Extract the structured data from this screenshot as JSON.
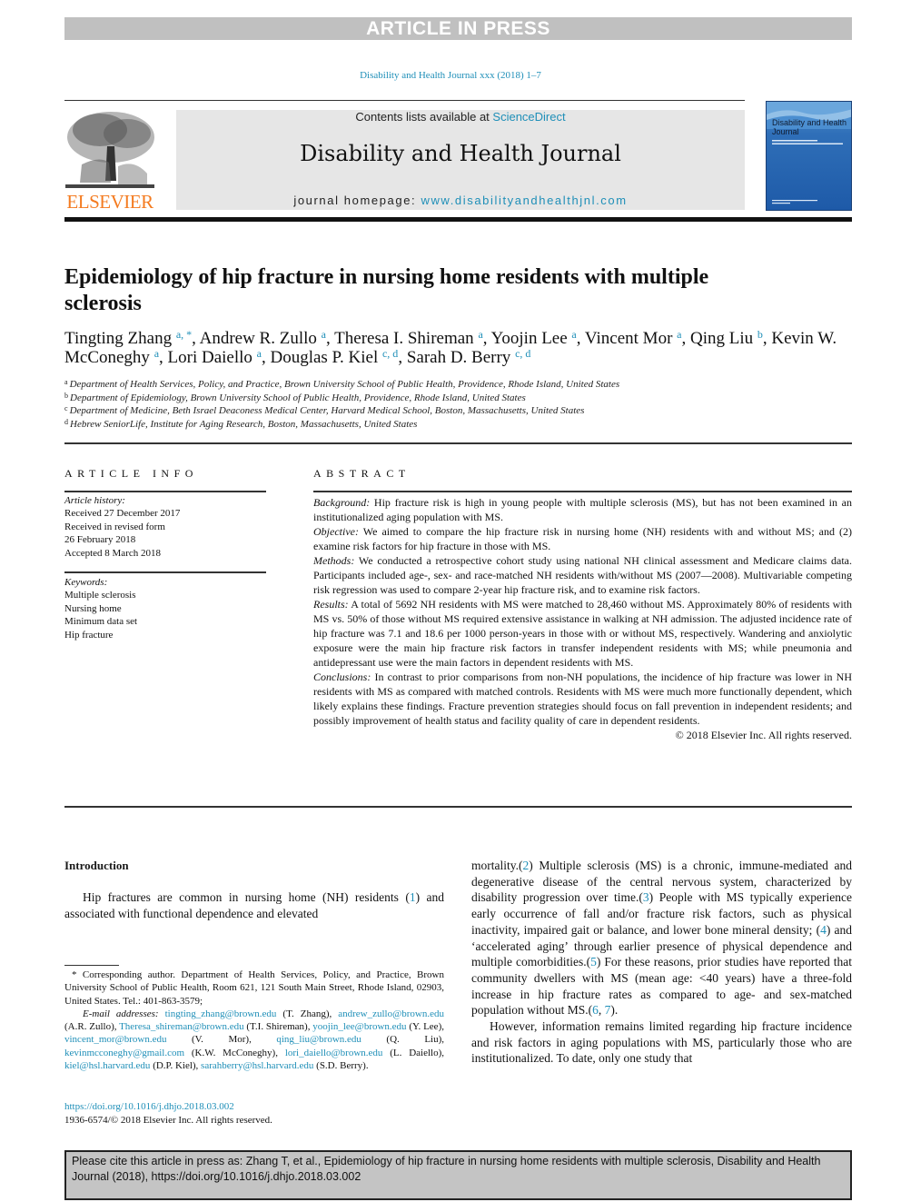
{
  "banner": {
    "text": "ARTICLE IN PRESS"
  },
  "journal_ref": "Disability and Health Journal xxx (2018) 1–7",
  "masthead": {
    "publisher_wordmark": "ELSEVIER",
    "publisher_logo_icon": "elsevier-tree-icon",
    "contents_prefix": "Contents lists available at ",
    "contents_link": "ScienceDirect",
    "journal_name": "Disability and Health Journal",
    "homepage_prefix": "journal homepage: ",
    "homepage_link": "www.disabilityandhealthjnl.com",
    "cover_title": "Disability and Health Journal"
  },
  "article": {
    "title": "Epidemiology of hip fracture in nursing home residents with multiple sclerosis",
    "authors": [
      {
        "name": "Tingting Zhang",
        "sup": "a, *",
        "sep": ", "
      },
      {
        "name": "Andrew R. Zullo",
        "sup": "a",
        "sep": ", "
      },
      {
        "name": "Theresa I. Shireman",
        "sup": "a",
        "sep": ", "
      },
      {
        "name": "Yoojin Lee",
        "sup": "a",
        "sep": ", "
      },
      {
        "name": "Vincent Mor",
        "sup": "a",
        "sep": ", "
      },
      {
        "name": "Qing Liu",
        "sup": "b",
        "sep": ", "
      },
      {
        "name": "Kevin W. McConeghy",
        "sup": "a",
        "sep": ", "
      },
      {
        "name": "Lori Daiello",
        "sup": "a",
        "sep": ", "
      },
      {
        "name": "Douglas P. Kiel",
        "sup": "c, d",
        "sep": ", "
      },
      {
        "name": "Sarah D. Berry",
        "sup": "c, d",
        "sep": ""
      }
    ],
    "affiliations": [
      {
        "key": "a",
        "text": "Department of Health Services, Policy, and Practice, Brown University School of Public Health, Providence, Rhode Island, United States"
      },
      {
        "key": "b",
        "text": "Department of Epidemiology, Brown University School of Public Health, Providence, Rhode Island, United States"
      },
      {
        "key": "c",
        "text": "Department of Medicine, Beth Israel Deaconess Medical Center, Harvard Medical School, Boston, Massachusetts, United States"
      },
      {
        "key": "d",
        "text": "Hebrew SeniorLife, Institute for Aging Research, Boston, Massachusetts, United States"
      }
    ]
  },
  "article_info": {
    "heading": "ARTICLE INFO",
    "history_label": "Article history:",
    "history": [
      "Received 27 December 2017",
      "Received in revised form",
      "26 February 2018",
      "Accepted 8 March 2018"
    ],
    "keywords_label": "Keywords:",
    "keywords": [
      "Multiple sclerosis",
      "Nursing home",
      "Minimum data set",
      "Hip fracture"
    ]
  },
  "abstract": {
    "heading": "ABSTRACT",
    "sections": [
      {
        "label": "Background:",
        "text": "Hip fracture risk is high in young people with multiple sclerosis (MS), but has not been examined in an institutionalized aging population with MS."
      },
      {
        "label": "Objective:",
        "text": "We aimed to compare the hip fracture risk in nursing home (NH) residents with and without MS; and (2) examine risk factors for hip fracture in those with MS."
      },
      {
        "label": "Methods:",
        "text": "We conducted a retrospective cohort study using national NH clinical assessment and Medicare claims data. Participants included age-, sex- and race-matched NH residents with/without MS (2007—2008). Multivariable competing risk regression was used to compare 2-year hip fracture risk, and to examine risk factors."
      },
      {
        "label": "Results:",
        "text": "A total of 5692 NH residents with MS were matched to 28,460 without MS. Approximately 80% of residents with MS vs. 50% of those without MS required extensive assistance in walking at NH admission. The adjusted incidence rate of hip fracture was 7.1 and 18.6 per 1000 person-years in those with or without MS, respectively. Wandering and anxiolytic exposure were the main hip fracture risk factors in transfer independent residents with MS; while pneumonia and antidepressant use were the main factors in dependent residents with MS."
      },
      {
        "label": "Conclusions:",
        "text": "In contrast to prior comparisons from non-NH populations, the incidence of hip fracture was lower in NH residents with MS as compared with matched controls. Residents with MS were much more functionally dependent, which likely explains these findings. Fracture prevention strategies should focus on fall prevention in independent residents; and possibly improvement of health status and facility quality of care in dependent residents."
      }
    ],
    "copyright": "© 2018 Elsevier Inc. All rights reserved."
  },
  "introduction": {
    "heading": "Introduction",
    "left_para": {
      "t1": "Hip fractures are common in nursing home (NH) residents (",
      "r1": "1",
      "t2": ") and associated with functional dependence and elevated"
    },
    "right_para1": {
      "t1": "mortality.(",
      "r1": "2",
      "t2": ") Multiple sclerosis (MS) is a chronic, immune-mediated and degenerative disease of the central nervous system, characterized by disability progression over time.(",
      "r2": "3",
      "t3": ") People with MS typically experience early occurrence of fall and/or fracture risk factors, such as physical inactivity, impaired gait or balance, and lower bone mineral density; (",
      "r3": "4",
      "t4": ") and ‘accelerated aging’ through earlier presence of physical dependence and multiple comorbidities.(",
      "r4": "5",
      "t5": ") For these reasons, prior studies have reported that community dwellers with MS (mean age: <40 years) have a three-fold increase in hip fracture rates as compared to age- and sex-matched population without MS.(",
      "r5": "6",
      "t6": ", ",
      "r6": "7",
      "t7": ")."
    },
    "right_para2": "However, information remains limited regarding hip fracture incidence and risk factors in aging populations with MS, particularly those who are institutionalized. To date, only one study that"
  },
  "footnote": {
    "corresponding": "* Corresponding author. Department of Health Services, Policy, and Practice, Brown University School of Public Health, Room 621, 121 South Main Street, Rhode Island, 02903, United States. Tel.: 401-863-3579;",
    "email_label": "E-mail addresses:",
    "emails": [
      {
        "email": "tingting_zhang@brown.edu",
        "who": " (T. Zhang), "
      },
      {
        "email": "andrew_zullo@brown.edu",
        "who": " (A.R. Zullo), "
      },
      {
        "email": "Theresa_shireman@brown.edu",
        "who": " (T.I. Shireman), "
      },
      {
        "email": "yoojin_lee@brown.edu",
        "who": " (Y. Lee), "
      },
      {
        "email": "vincent_mor@brown.edu",
        "who": " (V. Mor), "
      },
      {
        "email": "qing_liu@brown.edu",
        "who": " (Q. Liu), "
      },
      {
        "email": "kevinmcconeghy@gmail.com",
        "who": " (K.W. McConeghy), "
      },
      {
        "email": "lori_daiello@brown.edu",
        "who": " (L. Daiello), "
      },
      {
        "email": "kiel@hsl.harvard.edu",
        "who": " (D.P. Kiel), "
      },
      {
        "email": "sarahberry@hsl.harvard.edu",
        "who": " (S.D. Berry)."
      }
    ]
  },
  "doi": {
    "link": "https://doi.org/10.1016/j.dhjo.2018.03.002",
    "issn_line": "1936-6574/© 2018 Elsevier Inc. All rights reserved."
  },
  "cite_box": {
    "text": "Please cite this article in press as: Zhang T, et al., Epidemiology of hip fracture in nursing home residents with multiple sclerosis, Disability and Health Journal (2018), https://doi.org/10.1016/j.dhjo.2018.03.002"
  },
  "colors": {
    "link": "#1f8fb8",
    "elsevier_orange": "#f47b20",
    "banner_gray": "#c0c0c0",
    "masthead_gray": "#e6e6e6"
  }
}
